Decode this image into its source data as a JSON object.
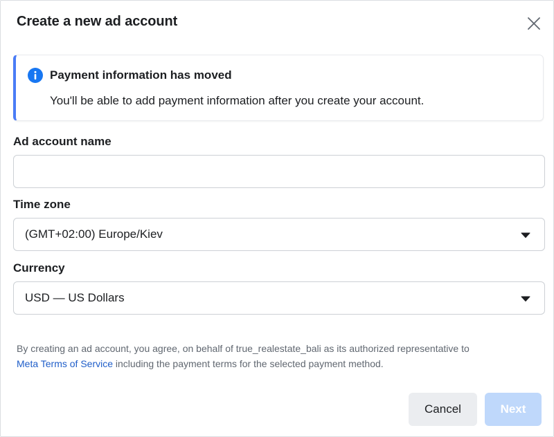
{
  "dialog": {
    "title": "Create a new ad account",
    "close_icon": "close-icon"
  },
  "notice": {
    "icon": "info-icon",
    "title": "Payment information has moved",
    "body": "You'll be able to add payment information after you create your account.",
    "accent_color": "#4a7cf6"
  },
  "form": {
    "account_name": {
      "label": "Ad account name",
      "value": "",
      "placeholder": ""
    },
    "time_zone": {
      "label": "Time zone",
      "selected": "(GMT+02:00) Europe/Kiev",
      "icon": "caret-down-icon"
    },
    "currency": {
      "label": "Currency",
      "selected": "USD — US Dollars",
      "icon": "caret-down-icon"
    }
  },
  "terms": {
    "text_before": "By creating an ad account, you agree, on behalf of true_realestate_bali as its authorized representative to",
    "link": "Meta Terms of Service",
    "text_after": "including the payment terms for the selected payment method.",
    "link_color": "#1f5ec9"
  },
  "footer": {
    "cancel_label": "Cancel",
    "next_label": "Next",
    "next_disabled": true,
    "next_color": "#bfd8fb"
  }
}
